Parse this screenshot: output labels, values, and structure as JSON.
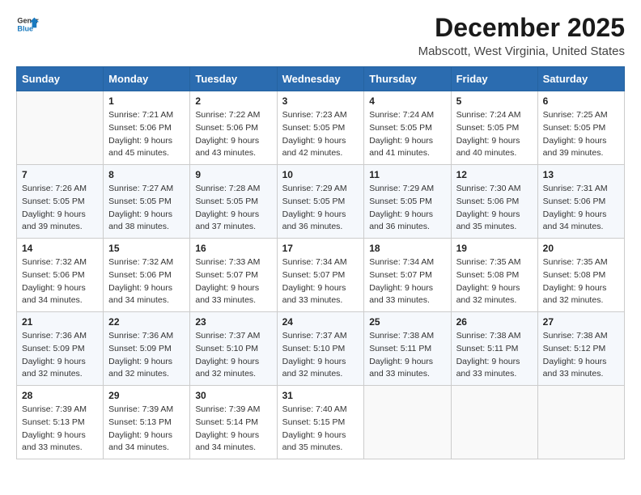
{
  "logo": {
    "line1": "General",
    "line2": "Blue"
  },
  "title": "December 2025",
  "location": "Mabscott, West Virginia, United States",
  "days_of_week": [
    "Sunday",
    "Monday",
    "Tuesday",
    "Wednesday",
    "Thursday",
    "Friday",
    "Saturday"
  ],
  "weeks": [
    [
      {
        "day": "",
        "info": ""
      },
      {
        "day": "1",
        "info": "Sunrise: 7:21 AM\nSunset: 5:06 PM\nDaylight: 9 hours\nand 45 minutes."
      },
      {
        "day": "2",
        "info": "Sunrise: 7:22 AM\nSunset: 5:06 PM\nDaylight: 9 hours\nand 43 minutes."
      },
      {
        "day": "3",
        "info": "Sunrise: 7:23 AM\nSunset: 5:05 PM\nDaylight: 9 hours\nand 42 minutes."
      },
      {
        "day": "4",
        "info": "Sunrise: 7:24 AM\nSunset: 5:05 PM\nDaylight: 9 hours\nand 41 minutes."
      },
      {
        "day": "5",
        "info": "Sunrise: 7:24 AM\nSunset: 5:05 PM\nDaylight: 9 hours\nand 40 minutes."
      },
      {
        "day": "6",
        "info": "Sunrise: 7:25 AM\nSunset: 5:05 PM\nDaylight: 9 hours\nand 39 minutes."
      }
    ],
    [
      {
        "day": "7",
        "info": "Sunrise: 7:26 AM\nSunset: 5:05 PM\nDaylight: 9 hours\nand 39 minutes."
      },
      {
        "day": "8",
        "info": "Sunrise: 7:27 AM\nSunset: 5:05 PM\nDaylight: 9 hours\nand 38 minutes."
      },
      {
        "day": "9",
        "info": "Sunrise: 7:28 AM\nSunset: 5:05 PM\nDaylight: 9 hours\nand 37 minutes."
      },
      {
        "day": "10",
        "info": "Sunrise: 7:29 AM\nSunset: 5:05 PM\nDaylight: 9 hours\nand 36 minutes."
      },
      {
        "day": "11",
        "info": "Sunrise: 7:29 AM\nSunset: 5:05 PM\nDaylight: 9 hours\nand 36 minutes."
      },
      {
        "day": "12",
        "info": "Sunrise: 7:30 AM\nSunset: 5:06 PM\nDaylight: 9 hours\nand 35 minutes."
      },
      {
        "day": "13",
        "info": "Sunrise: 7:31 AM\nSunset: 5:06 PM\nDaylight: 9 hours\nand 34 minutes."
      }
    ],
    [
      {
        "day": "14",
        "info": "Sunrise: 7:32 AM\nSunset: 5:06 PM\nDaylight: 9 hours\nand 34 minutes."
      },
      {
        "day": "15",
        "info": "Sunrise: 7:32 AM\nSunset: 5:06 PM\nDaylight: 9 hours\nand 34 minutes."
      },
      {
        "day": "16",
        "info": "Sunrise: 7:33 AM\nSunset: 5:07 PM\nDaylight: 9 hours\nand 33 minutes."
      },
      {
        "day": "17",
        "info": "Sunrise: 7:34 AM\nSunset: 5:07 PM\nDaylight: 9 hours\nand 33 minutes."
      },
      {
        "day": "18",
        "info": "Sunrise: 7:34 AM\nSunset: 5:07 PM\nDaylight: 9 hours\nand 33 minutes."
      },
      {
        "day": "19",
        "info": "Sunrise: 7:35 AM\nSunset: 5:08 PM\nDaylight: 9 hours\nand 32 minutes."
      },
      {
        "day": "20",
        "info": "Sunrise: 7:35 AM\nSunset: 5:08 PM\nDaylight: 9 hours\nand 32 minutes."
      }
    ],
    [
      {
        "day": "21",
        "info": "Sunrise: 7:36 AM\nSunset: 5:09 PM\nDaylight: 9 hours\nand 32 minutes."
      },
      {
        "day": "22",
        "info": "Sunrise: 7:36 AM\nSunset: 5:09 PM\nDaylight: 9 hours\nand 32 minutes."
      },
      {
        "day": "23",
        "info": "Sunrise: 7:37 AM\nSunset: 5:10 PM\nDaylight: 9 hours\nand 32 minutes."
      },
      {
        "day": "24",
        "info": "Sunrise: 7:37 AM\nSunset: 5:10 PM\nDaylight: 9 hours\nand 32 minutes."
      },
      {
        "day": "25",
        "info": "Sunrise: 7:38 AM\nSunset: 5:11 PM\nDaylight: 9 hours\nand 33 minutes."
      },
      {
        "day": "26",
        "info": "Sunrise: 7:38 AM\nSunset: 5:11 PM\nDaylight: 9 hours\nand 33 minutes."
      },
      {
        "day": "27",
        "info": "Sunrise: 7:38 AM\nSunset: 5:12 PM\nDaylight: 9 hours\nand 33 minutes."
      }
    ],
    [
      {
        "day": "28",
        "info": "Sunrise: 7:39 AM\nSunset: 5:13 PM\nDaylight: 9 hours\nand 33 minutes."
      },
      {
        "day": "29",
        "info": "Sunrise: 7:39 AM\nSunset: 5:13 PM\nDaylight: 9 hours\nand 34 minutes."
      },
      {
        "day": "30",
        "info": "Sunrise: 7:39 AM\nSunset: 5:14 PM\nDaylight: 9 hours\nand 34 minutes."
      },
      {
        "day": "31",
        "info": "Sunrise: 7:40 AM\nSunset: 5:15 PM\nDaylight: 9 hours\nand 35 minutes."
      },
      {
        "day": "",
        "info": ""
      },
      {
        "day": "",
        "info": ""
      },
      {
        "day": "",
        "info": ""
      }
    ]
  ]
}
